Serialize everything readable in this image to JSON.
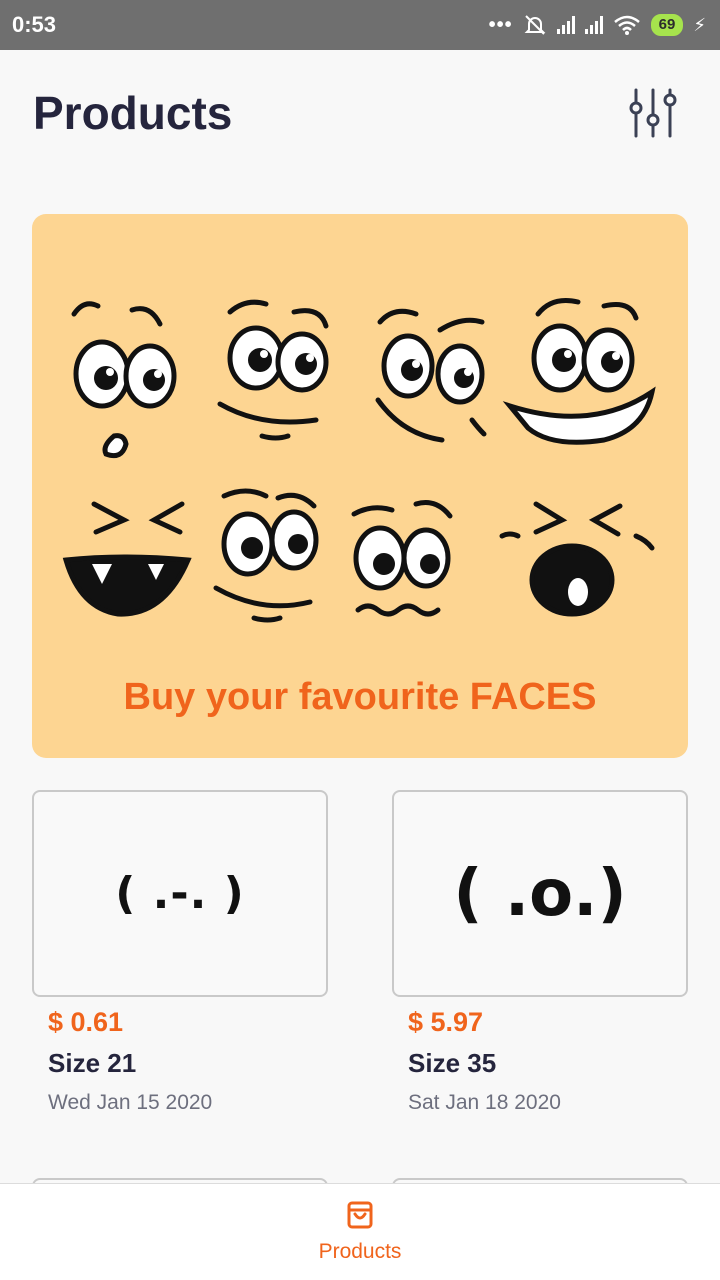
{
  "status_bar": {
    "time": "0:53",
    "battery": "69",
    "dots": "•••"
  },
  "header": {
    "title": "Products",
    "filter_icon": "sliders-icon"
  },
  "banner": {
    "caption": "Buy your favourite FACES",
    "background": "#fdd592",
    "accent": "#f0641c"
  },
  "products": [
    {
      "face": "( .-. )",
      "price": "$ 0.61",
      "size": "Size 21",
      "date": "Wed Jan 15 2020"
    },
    {
      "face": "( .o.)",
      "price": "$ 5.97",
      "size": "Size 35",
      "date": "Sat Jan 18 2020"
    }
  ],
  "bottom_nav": {
    "items": [
      {
        "label": "Products",
        "icon": "shopping-bag-icon",
        "active": true
      }
    ]
  }
}
